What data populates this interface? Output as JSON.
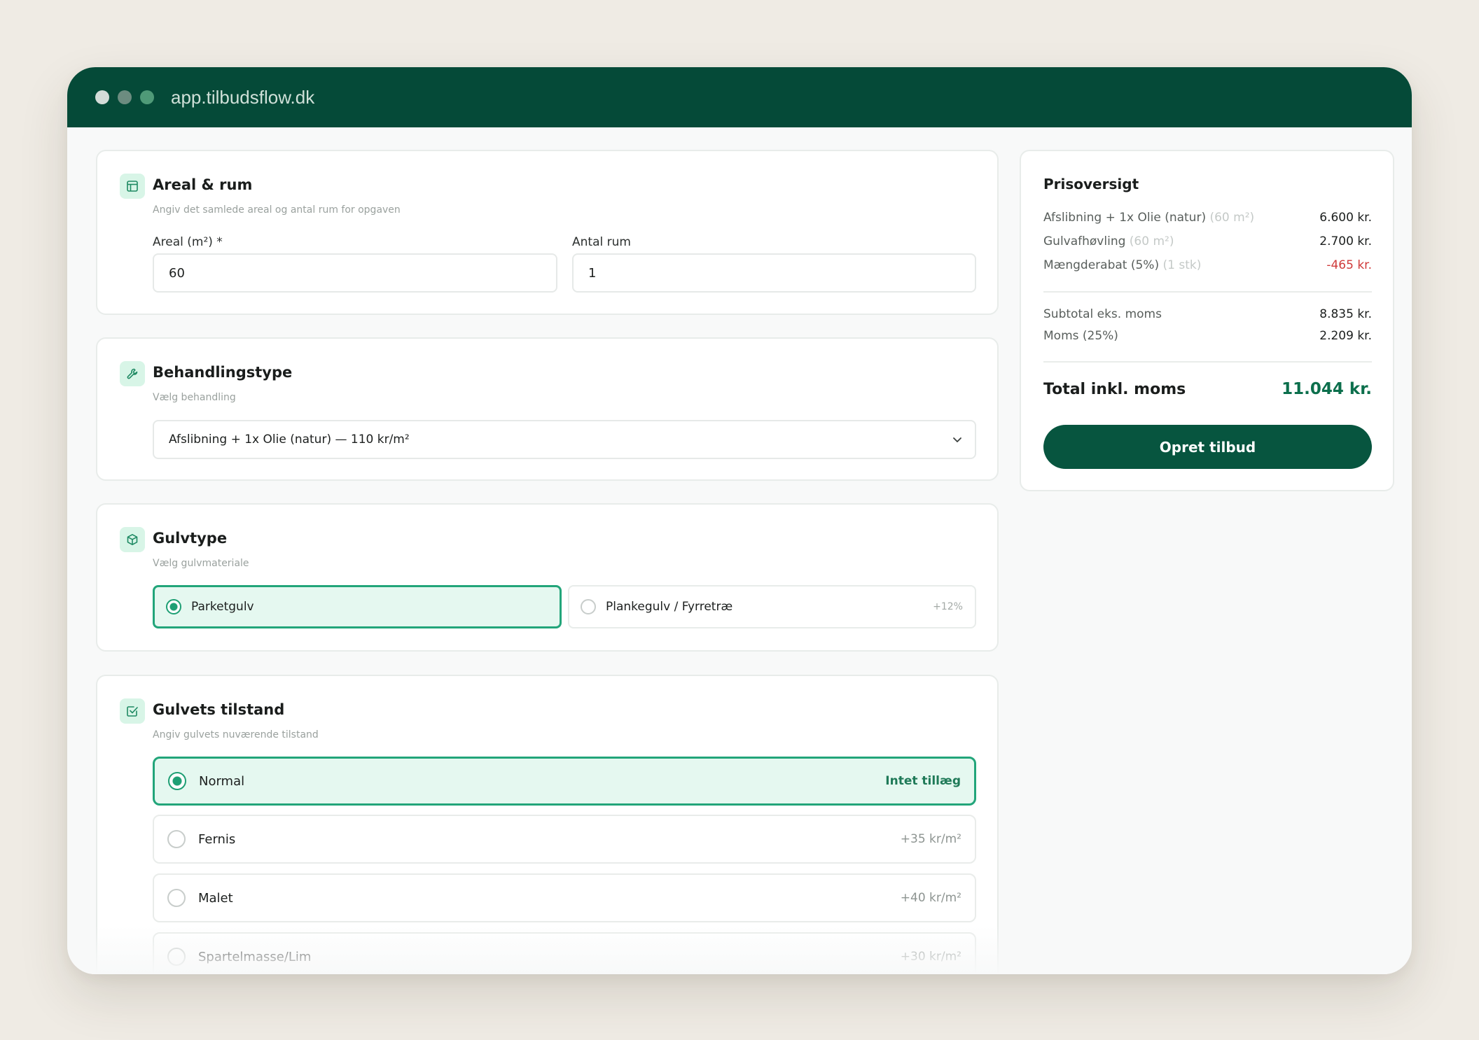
{
  "browser": {
    "url": "app.tilbudsflow.dk"
  },
  "sections": {
    "area": {
      "icon": "table-icon",
      "title": "Areal & rum",
      "subtitle": "Angiv det samlede areal og antal rum for opgaven",
      "area_label": "Areal (m²) *",
      "area_value": "60",
      "rooms_label": "Antal rum",
      "rooms_value": "1"
    },
    "treatment": {
      "icon": "wrench-icon",
      "title": "Behandlingstype",
      "subtitle": "Vælg behandling",
      "selected": "Afslibning + 1x Olie (natur) — 110 kr/m²"
    },
    "floor_type": {
      "icon": "box-icon",
      "title": "Gulvtype",
      "subtitle": "Vælg gulvmateriale",
      "options": [
        {
          "label": "Parketgulv",
          "extra": "",
          "selected": true
        },
        {
          "label": "Plankegulv / Fyrretræ",
          "extra": "+12%",
          "selected": false
        }
      ]
    },
    "condition": {
      "icon": "checkbox-icon",
      "title": "Gulvets tilstand",
      "subtitle": "Angiv gulvets nuværende tilstand",
      "options": [
        {
          "label": "Normal",
          "extra": "Intet tillæg",
          "selected": true
        },
        {
          "label": "Fernis",
          "extra": "+35 kr/m²",
          "selected": false
        },
        {
          "label": "Malet",
          "extra": "+40 kr/m²",
          "selected": false
        },
        {
          "label": "Spartelmasse/Lim",
          "extra": "+30 kr/m²",
          "selected": false
        }
      ]
    }
  },
  "price_overview": {
    "title": "Prisoversigt",
    "lines": [
      {
        "label": "Afslibning + 1x Olie (natur)",
        "note": "(60 m²)",
        "value": "6.600 kr."
      },
      {
        "label": "Gulvafhøvling",
        "note": "(60 m²)",
        "value": "2.700 kr."
      },
      {
        "label": "Mængderabat (5%)",
        "note": "(1 stk)",
        "value": "-465 kr."
      }
    ],
    "subtotal_label": "Subtotal eks. moms",
    "subtotal_value": "8.835 kr.",
    "vat_label": "Moms (25%)",
    "vat_value": "2.209 kr.",
    "total_label": "Total inkl. moms",
    "total_value": "11.044 kr.",
    "button_label": "Opret tilbud"
  },
  "colors": {
    "brand": "#054a38",
    "accent": "#22a57a",
    "total": "#0c6f4c",
    "discount": "#cf3a3a",
    "background": "#efebe4"
  }
}
